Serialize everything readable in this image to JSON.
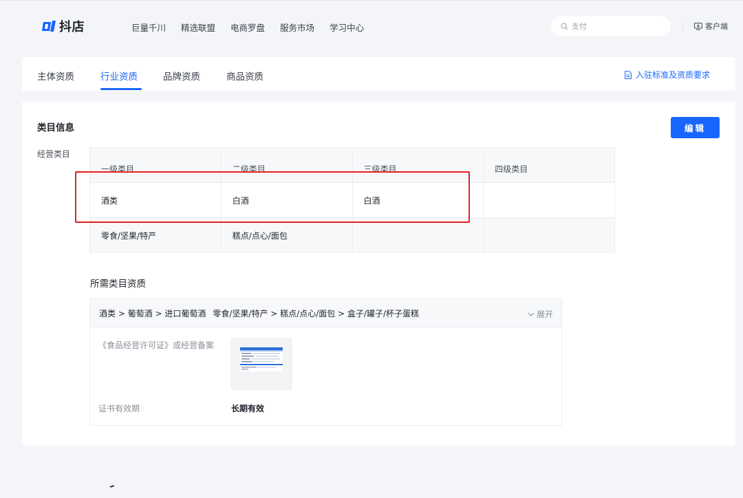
{
  "brand": {
    "name": "抖店",
    "accent": "#1966ff"
  },
  "nav": {
    "links": [
      "巨量千川",
      "精选联盟",
      "电商罗盘",
      "服务市场",
      "学习中心"
    ],
    "search_placeholder": "支付",
    "client_label": "客户端"
  },
  "tabs": {
    "items": [
      "主体资质",
      "行业资质",
      "品牌资质",
      "商品资质"
    ],
    "active": "行业资质",
    "requirements_link": "入驻标准及资质要求"
  },
  "category_info": {
    "title": "类目信息",
    "edit_label": "编辑",
    "field_label": "经营类目",
    "columns": [
      "一级类目",
      "二级类目",
      "三级类目",
      "四级类目"
    ],
    "rows": [
      [
        "酒类",
        "白酒",
        "白酒",
        ""
      ],
      [
        "零食/坚果/特产",
        "糕点/点心/面包",
        "",
        ""
      ]
    ],
    "highlight_color": "#e02020"
  },
  "required_qualifications": {
    "title": "所需类目资质",
    "paths": [
      "酒类 > 葡萄酒 > 进口葡萄酒",
      "零食/坚果/特产 > 糕点/点心/面包 > 盒子/罐子/杯子蛋糕"
    ],
    "expand_label": "展开",
    "license_name": "《食品经营许可证》或经营备案",
    "validity_label": "证书有效期",
    "validity_value": "长期有效"
  }
}
